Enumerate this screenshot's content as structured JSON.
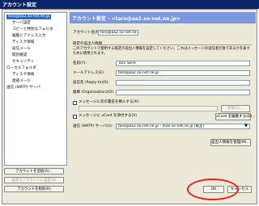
{
  "window": {
    "title": "アカウント設定"
  },
  "tree": {
    "items": [
      {
        "label": "taro@aa2.so-net.ne.jp"
      },
      {
        "label": "サーバ設定"
      },
      {
        "label": "コピーと特別なフォルダ"
      },
      {
        "label": "編集とアドレス入力"
      },
      {
        "label": "ディスク領域"
      },
      {
        "label": "返信メール"
      },
      {
        "label": "開封確認"
      },
      {
        "label": "セキュリティ"
      },
      {
        "label": "ローカルフォルダ"
      },
      {
        "label": "ディスク領域"
      },
      {
        "label": "迷惑メール"
      },
      {
        "label": "送信 (SMTP) サーバ"
      }
    ],
    "buttons": {
      "add": "アカウントを追加(A)...",
      "default": "既定のアカウントに設定(D)",
      "remove": "アカウントを削除(R)"
    }
  },
  "panel": {
    "title": "アカウント設定 - <taro@aa2.so-net.ne.jp>",
    "account_name_label": "アカウント名(N):",
    "account_name_value": "taro@aa2.so-net.ne.jp",
    "section_title": "既定の差出人情報",
    "note": "このアカウントで使用する既定の差出人情報を設定してください。これはメッセージの送信者が誰であるかを表すために使用されます。",
    "name_label": "名前(Y):",
    "name_value": "Taro Sone",
    "email_label": "メールアドレス(E):",
    "email_value": "taro@aa2.so-net.ne.jp",
    "replyto_label": "返信先 (Reply-to)(S):",
    "replyto_value": "",
    "org_label": "組織 (Organization)(O):",
    "org_value": "",
    "sig_label": "メッセージに次の署名を挿入する(X):",
    "sig_value": "",
    "browse_label": "参照(C)...",
    "vcard_label": "メッセージに vCard を添付する(V)",
    "vcard_edit_label": "vCard を編集する(D)...",
    "smtp_label": "送信 (SMTP) サーバ(U):",
    "smtp_value": "taro@aa2.so-net.ne.jp - mail.so-net.ne.jp (既定)",
    "identity_button": "差出人情報を管理(M)..."
  },
  "footer": {
    "ok": "OK",
    "cancel": "キャンセル"
  }
}
